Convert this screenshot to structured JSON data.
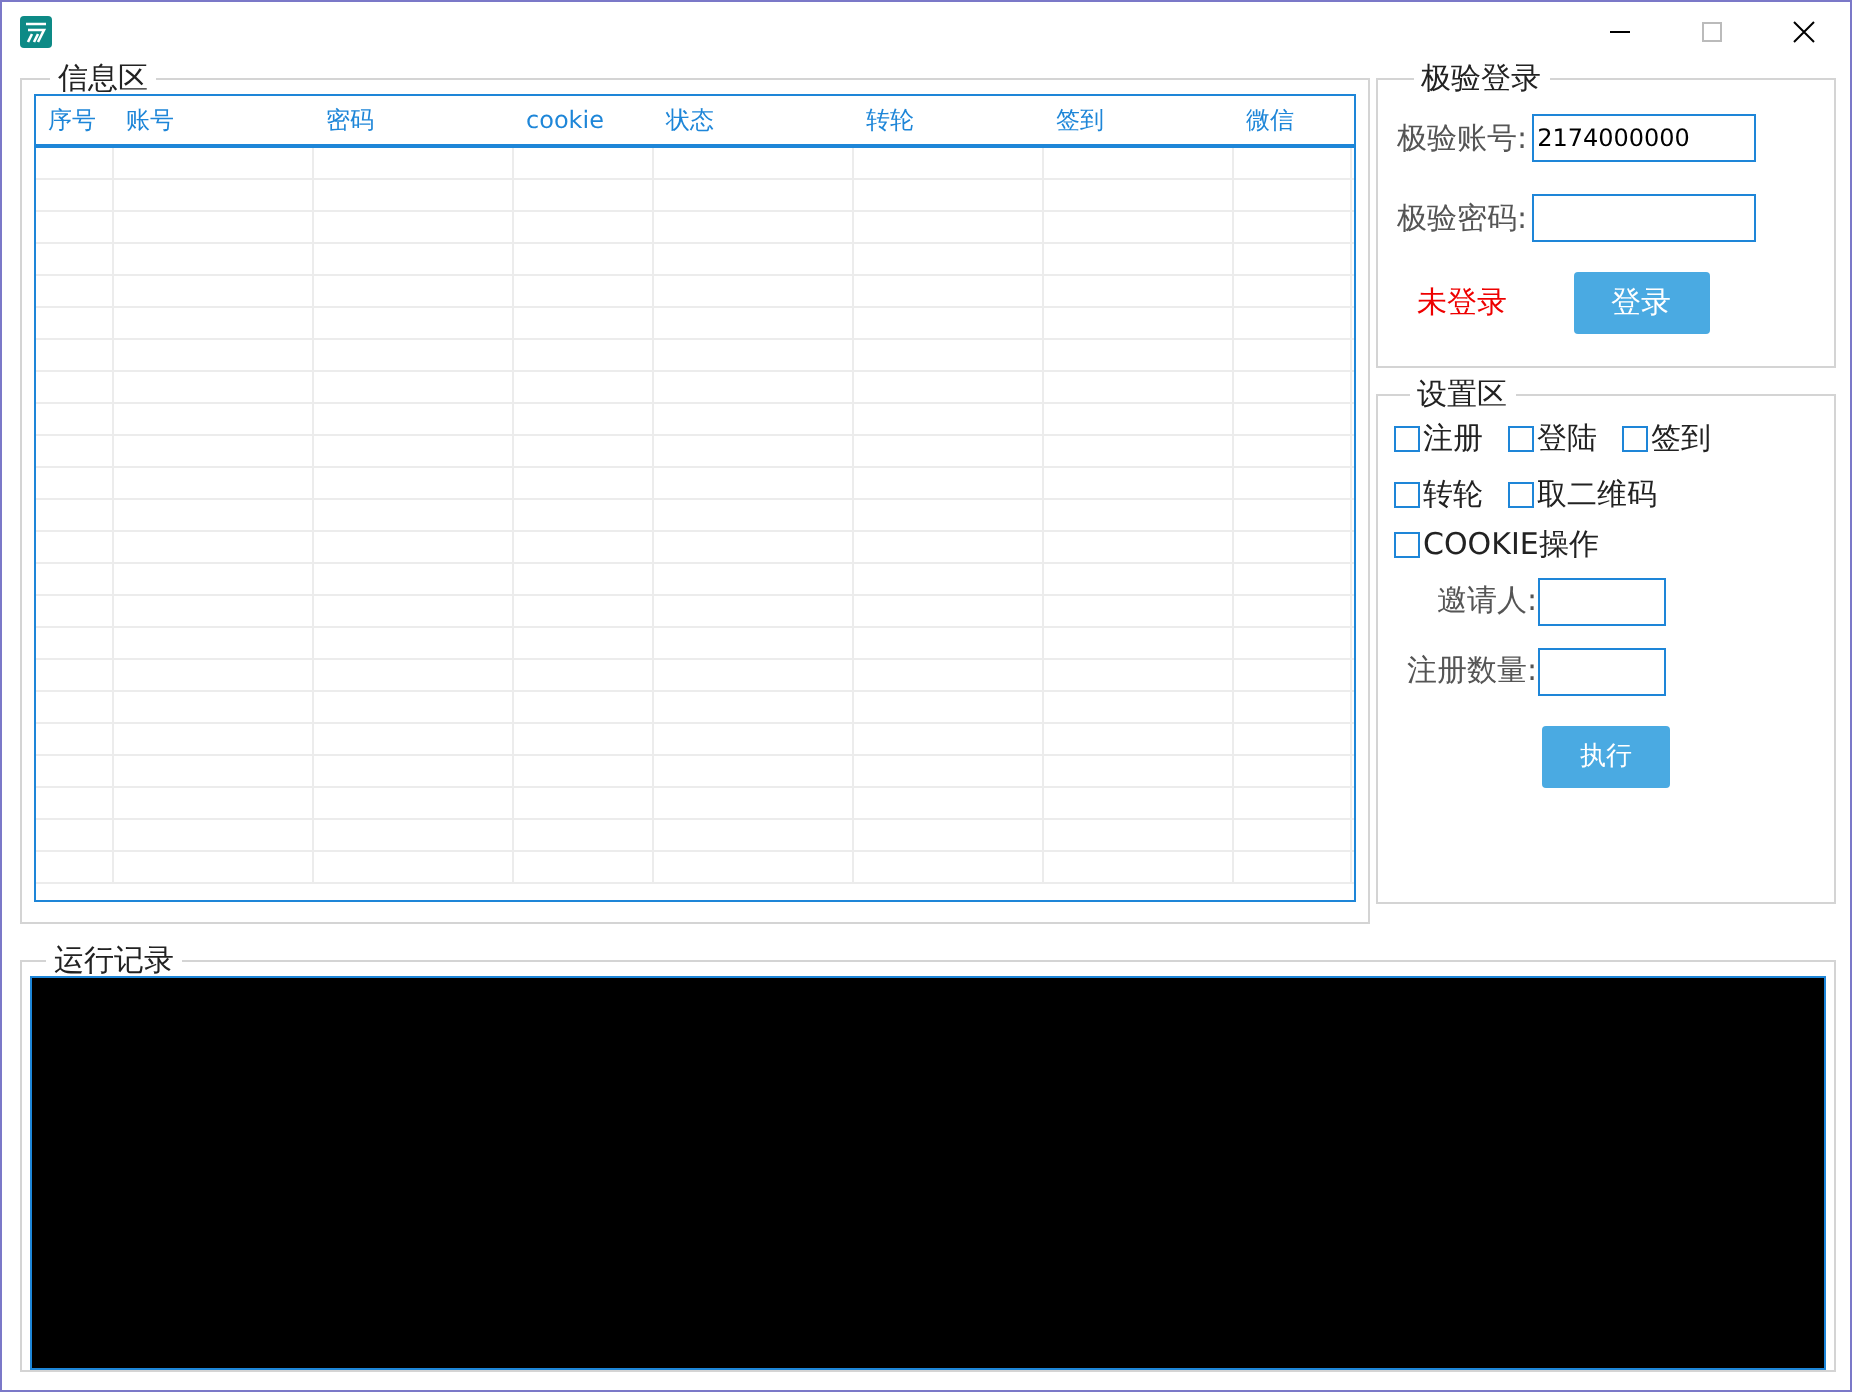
{
  "info_group": {
    "title": "信息区",
    "table": {
      "columns": [
        "序号",
        "账号",
        "密码",
        "cookie",
        "状态",
        "转轮",
        "签到",
        "微信"
      ]
    }
  },
  "login_group": {
    "title": "极验登录",
    "fields": [
      {
        "label": "极验账号:",
        "value": "2174000000"
      },
      {
        "label": "极验密码:"
      }
    ],
    "status": "未登录",
    "button": "登录"
  },
  "settings_group": {
    "title": "设置区",
    "checkbox_rows": [
      [
        {
          "label": "注册",
          "checked": false
        },
        {
          "label": "登陆",
          "checked": false
        },
        {
          "label": "签到",
          "checked": false
        }
      ],
      [
        {
          "label": "转轮",
          "checked": false
        },
        {
          "label": "取二维码",
          "checked": false
        }
      ],
      [
        {
          "label": "COOKIE操作",
          "checked": false
        }
      ]
    ],
    "fields": [
      {
        "label": "邀请人:"
      },
      {
        "label": "注册数量:"
      }
    ],
    "button": "执行"
  },
  "log_group": {
    "title": "运行记录"
  }
}
